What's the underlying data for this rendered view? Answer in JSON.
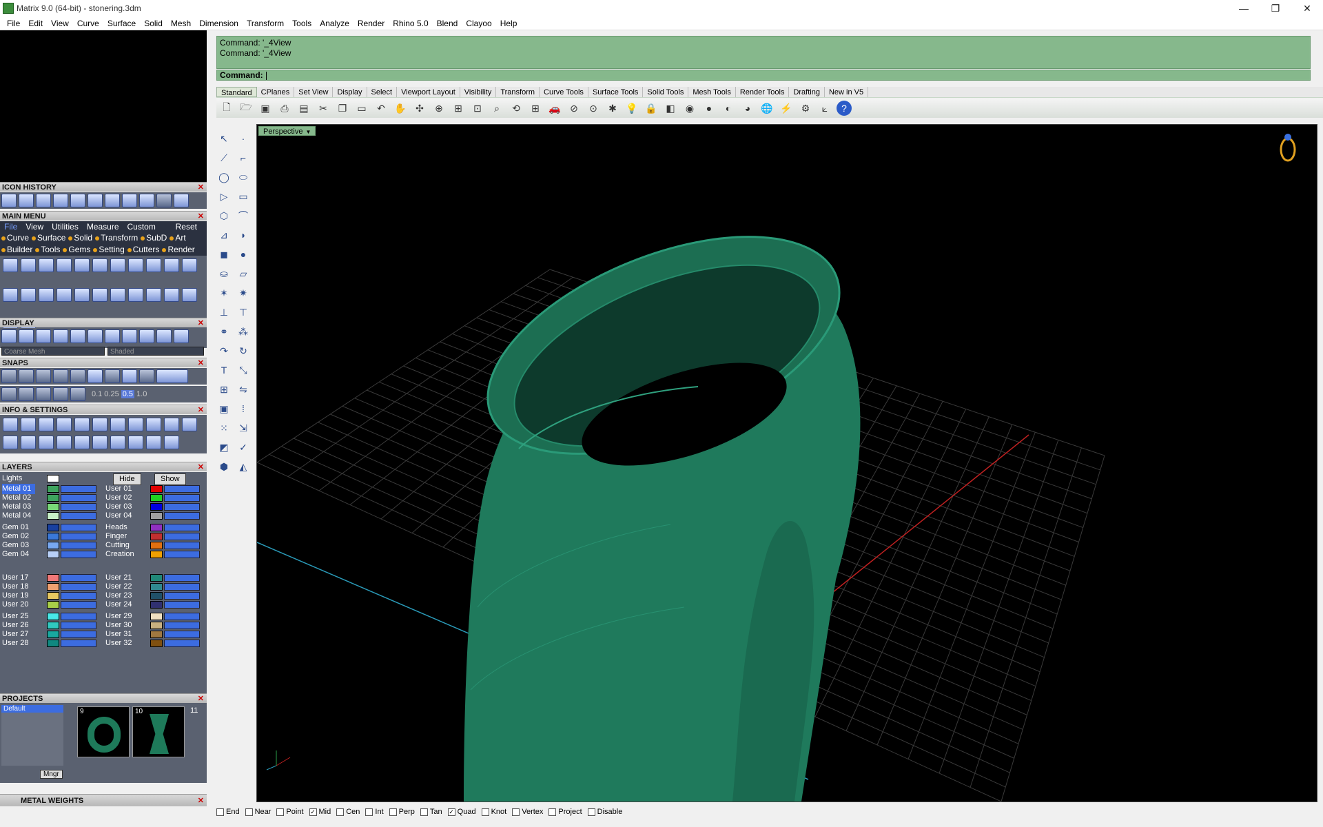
{
  "window": {
    "title": "Matrix 9.0 (64-bit) - stonering.3dm",
    "min": "—",
    "max": "❐",
    "close": "✕"
  },
  "menubar": [
    "File",
    "Edit",
    "View",
    "Curve",
    "Surface",
    "Solid",
    "Mesh",
    "Dimension",
    "Transform",
    "Tools",
    "Analyze",
    "Render",
    "Rhino 5.0",
    "Blend",
    "Clayoo",
    "Help"
  ],
  "panels": {
    "icon_history": "ICON HISTORY",
    "main_menu": "MAIN MENU",
    "display": "DISPLAY",
    "snaps": "SNAPS",
    "info": "INFO & SETTINGS",
    "layers": "LAYERS",
    "projects": "PROJECTS",
    "metal_weights": "METAL WEIGHTS"
  },
  "main_menu": {
    "tabs": [
      "File",
      "View",
      "Utilities",
      "Measure",
      "Custom"
    ],
    "reset": "Reset",
    "cats1": [
      "Curve",
      "Surface",
      "Solid",
      "Transform",
      "SubD",
      "Art"
    ],
    "cats2": [
      "Builder",
      "Tools",
      "Gems",
      "Setting",
      "Cutters",
      "Render"
    ]
  },
  "display": {
    "mesh": "Coarse Mesh",
    "mode": "Shaded"
  },
  "snaps_values": [
    "0.1",
    "0.25",
    "0.5",
    "1.0"
  ],
  "layers": {
    "lights": "Lights",
    "hide": "Hide",
    "show": "Show",
    "col1": [
      "Metal 01",
      "Metal 02",
      "Metal 03",
      "Metal 04",
      "Gem 01",
      "Gem 02",
      "Gem 03",
      "Gem 04",
      "User 17",
      "User 18",
      "User 19",
      "User 20",
      "User 25",
      "User 26",
      "User 27",
      "User 28"
    ],
    "col2": [
      "User 01",
      "User 02",
      "User 03",
      "User 04",
      "Heads",
      "Finger",
      "Cutting",
      "Creation",
      "User 21",
      "User 22",
      "User 23",
      "User 24",
      "User 29",
      "User 30",
      "User 31",
      "User 32"
    ],
    "col1_colors": [
      "#3ea35e",
      "#3ea35e",
      "#78d878",
      "#c8f0c8",
      "#1840a0",
      "#3a78d8",
      "#78a8f0",
      "#b8d0f8",
      "#f07878",
      "#f0a070",
      "#e8c860",
      "#a8d048",
      "#48e8e8",
      "#30c8c0",
      "#18a8a0",
      "#108880"
    ],
    "col2_colors": [
      "#e00000",
      "#20d020",
      "#0000e0",
      "#a0a0a0",
      "#9030c0",
      "#c03030",
      "#e07010",
      "#f0a000",
      "#208878",
      "#308890",
      "#205068",
      "#303070",
      "#f0e0c0",
      "#c8b080",
      "#a07840",
      "#805010"
    ]
  },
  "projects": {
    "default": "Default",
    "n1": "9",
    "n2": "10",
    "n3": "11",
    "mngr": "Mngr"
  },
  "command": {
    "history": [
      "Command: '_4View",
      "Command: '_4View"
    ],
    "prompt": "Command:"
  },
  "tabs": [
    "Standard",
    "CPlanes",
    "Set View",
    "Display",
    "Select",
    "Viewport Layout",
    "Visibility",
    "Transform",
    "Curve Tools",
    "Surface Tools",
    "Solid Tools",
    "Mesh Tools",
    "Render Tools",
    "Drafting",
    "New in V5"
  ],
  "viewport": {
    "label": "Perspective"
  },
  "osnaps": [
    {
      "label": "End",
      "checked": false
    },
    {
      "label": "Near",
      "checked": false
    },
    {
      "label": "Point",
      "checked": false
    },
    {
      "label": "Mid",
      "checked": true
    },
    {
      "label": "Cen",
      "checked": false
    },
    {
      "label": "Int",
      "checked": false
    },
    {
      "label": "Perp",
      "checked": false
    },
    {
      "label": "Tan",
      "checked": false
    },
    {
      "label": "Quad",
      "checked": true
    },
    {
      "label": "Knot",
      "checked": false
    },
    {
      "label": "Vertex",
      "checked": false
    },
    {
      "label": "Project",
      "checked": false
    },
    {
      "label": "Disable",
      "checked": false
    }
  ],
  "colors": {
    "command_bg": "#86b88c",
    "ring": "#1e7a5a",
    "axis_x": "#c02020",
    "axis_y": "#2a9ab8"
  }
}
